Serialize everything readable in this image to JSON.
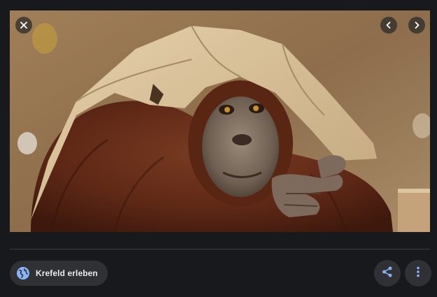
{
  "image": {
    "alt": "",
    "subject": "orangutan-with-paper-bag"
  },
  "controls": {
    "close_icon": "close-icon",
    "prev_icon": "chevron-left-icon",
    "next_icon": "chevron-right-icon"
  },
  "source": {
    "label": "Krefeld erleben",
    "icon": "globe-icon"
  },
  "actions": {
    "share_icon": "share-icon",
    "more_icon": "more-vert-icon"
  },
  "colors": {
    "background": "#17191c",
    "chip": "#303134",
    "accent": "#8ab4f8",
    "text": "#e8eaed"
  }
}
